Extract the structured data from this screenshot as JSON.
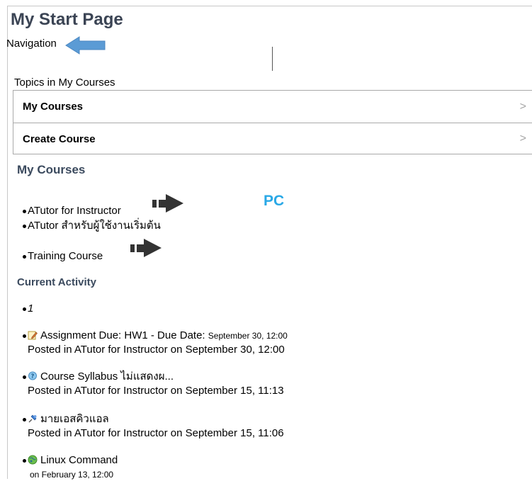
{
  "page": {
    "title": "My Start Page",
    "nav_label": "Navigation"
  },
  "topics": {
    "label": "Topics in My Courses",
    "items": [
      {
        "label": "My Courses",
        "chevron": ">"
      },
      {
        "label": "Create Course",
        "chevron": ">"
      }
    ]
  },
  "my_courses": {
    "heading": "My Courses",
    "items": [
      {
        "label": "ATutor for Instructor"
      },
      {
        "label": "ATutor สำหรับผู้ใช้งานเริ่มต้น"
      },
      {
        "label": "Training Course"
      }
    ]
  },
  "annotation": {
    "pc_label": "PC",
    "blue_arrow_color": "#5b9bd5",
    "dark_arrow_color": "#333333"
  },
  "current_activity": {
    "heading": "Current Activity",
    "items": [
      {
        "title": "1"
      },
      {
        "icon": "pencil-note-icon",
        "title": "Assignment Due: HW1 - Due Date: ",
        "date_inline": "September 30, 12:00",
        "posted": "Posted in ATutor for Instructor on September 30, 12:00"
      },
      {
        "icon": "question-bubble-icon",
        "title": "Course Syllabus ไม่แสดงผ...",
        "posted": "Posted in ATutor for Instructor on September 15, 11:13"
      },
      {
        "icon": "pushpin-icon",
        "title": "มายเอสคิวแอล",
        "posted": "Posted in ATutor for Instructor on September 15, 11:06"
      },
      {
        "icon": "globe-icon",
        "title": "Linux Command",
        "posted": "on February 13, 12:00"
      }
    ]
  }
}
